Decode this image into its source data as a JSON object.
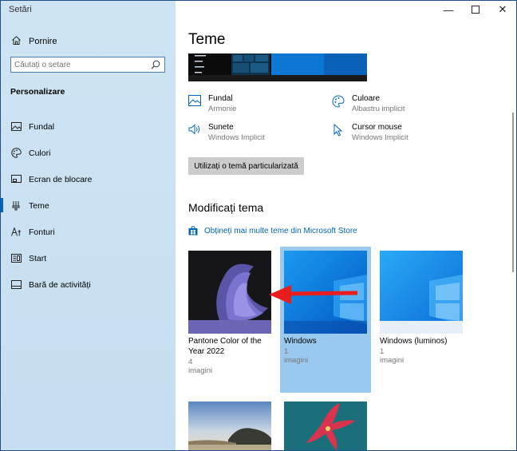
{
  "window": {
    "title": "Setări"
  },
  "sidebar": {
    "home_label": "Pornire",
    "search_placeholder": "Căutați o setare",
    "section": "Personalizare",
    "items": [
      {
        "label": "Fundal",
        "icon": "picture-icon"
      },
      {
        "label": "Culori",
        "icon": "palette-icon"
      },
      {
        "label": "Ecran de blocare",
        "icon": "lock-screen-icon"
      },
      {
        "label": "Teme",
        "icon": "brush-icon",
        "active": true
      },
      {
        "label": "Fonturi",
        "icon": "font-icon"
      },
      {
        "label": "Start",
        "icon": "start-icon"
      },
      {
        "label": "Bară de activități",
        "icon": "taskbar-icon"
      }
    ]
  },
  "main": {
    "title": "Teme",
    "properties": {
      "background": {
        "label": "Fundal",
        "value": "Armonie"
      },
      "color": {
        "label": "Culoare",
        "value": "Albastru implicit"
      },
      "sounds": {
        "label": "Sunete",
        "value": "Windows Implicit"
      },
      "cursor": {
        "label": "Cursor mouse",
        "value": "Windows Implicit"
      }
    },
    "custom_theme_button": "Utilizați o temă particularizată",
    "change_theme_title": "Modificați tema",
    "store_link": "Obțineți mai multe teme din Microsoft Store",
    "themes": [
      {
        "name": "Pantone Color of the Year 2022",
        "count": "4 imagini",
        "selected": false
      },
      {
        "name": "Windows",
        "count": "1 imagini",
        "selected": true
      },
      {
        "name": "Windows (luminos)",
        "count": "1 imagini",
        "selected": false
      }
    ]
  },
  "colors": {
    "accent": "#0067c0",
    "sidebar_bg": "#cfe4f3",
    "selection": "#99c9ef",
    "arrow": "#e81e1e"
  }
}
